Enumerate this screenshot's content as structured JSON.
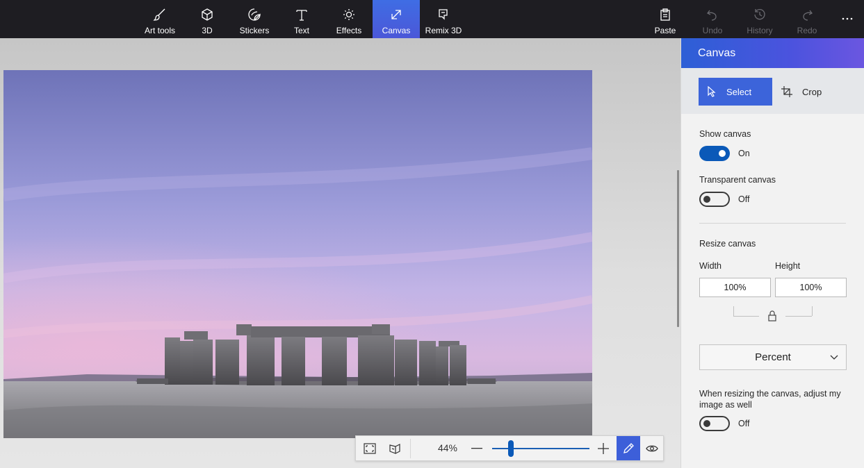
{
  "toolbar": {
    "tools": [
      {
        "label": "Art tools",
        "icon": "brush-icon"
      },
      {
        "label": "3D",
        "icon": "cube-icon"
      },
      {
        "label": "Stickers",
        "icon": "sticker-icon"
      },
      {
        "label": "Text",
        "icon": "text-t-icon"
      },
      {
        "label": "Effects",
        "icon": "sun-icon"
      },
      {
        "label": "Canvas",
        "icon": "resize-arrow-icon",
        "active": true
      },
      {
        "label": "Remix 3D",
        "icon": "remix-icon"
      }
    ],
    "actions": [
      {
        "label": "Paste",
        "icon": "clipboard-icon",
        "enabled": true
      },
      {
        "label": "Undo",
        "icon": "undo-icon",
        "enabled": false
      },
      {
        "label": "History",
        "icon": "history-icon",
        "enabled": false
      },
      {
        "label": "Redo",
        "icon": "redo-icon",
        "enabled": false
      }
    ],
    "more_icon": "ellipsis-icon"
  },
  "zoombar": {
    "zoom_value": "44%",
    "zoom_level": 0.19
  },
  "panel": {
    "title": "Canvas",
    "modes": {
      "select_label": "Select",
      "crop_label": "Crop"
    },
    "show_canvas": {
      "label": "Show canvas",
      "state": "On"
    },
    "transparent_canvas": {
      "label": "Transparent canvas",
      "state": "Off"
    },
    "resize": {
      "heading": "Resize canvas",
      "width_label": "Width",
      "height_label": "Height",
      "width_value": "100%",
      "height_value": "100%",
      "unit": "Percent"
    },
    "adjust_image": {
      "label": "When resizing the canvas, adjust my image as well",
      "state": "Off"
    }
  },
  "colors": {
    "toolbar_bg": "#1e1d22",
    "accent": "#3c64da",
    "toggle_on": "#0a59b8"
  }
}
